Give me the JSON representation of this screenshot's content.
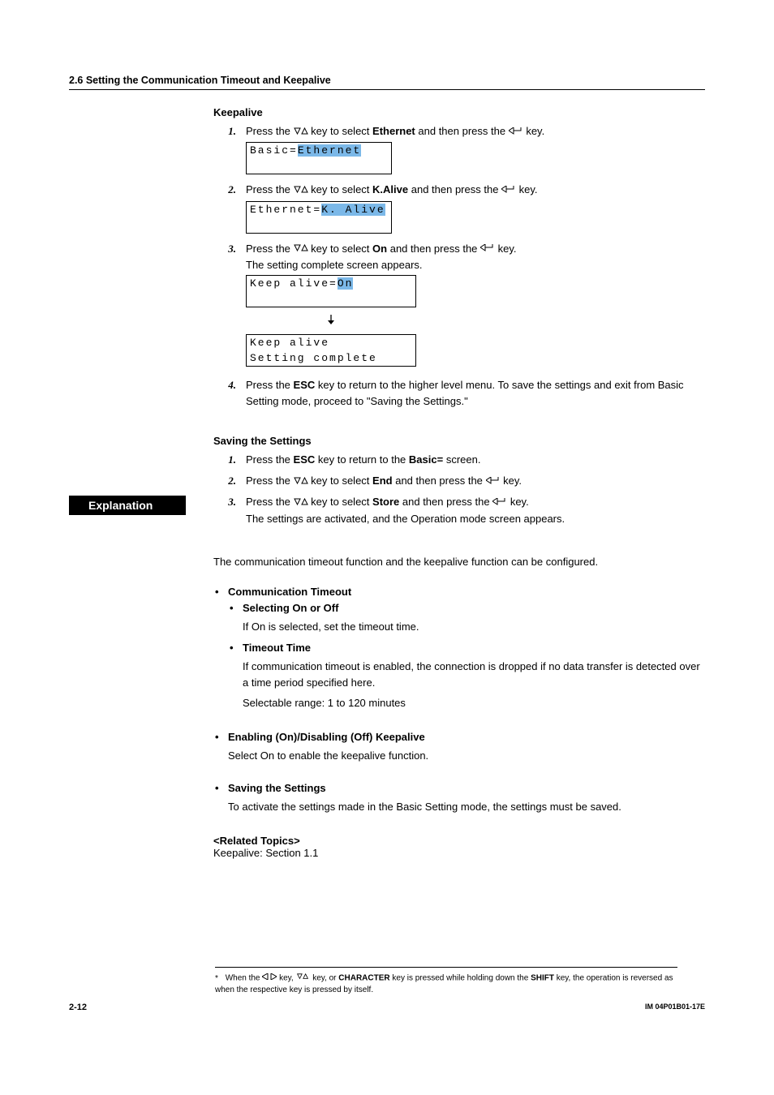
{
  "header": {
    "title": "2.6  Setting the Communication Timeout and Keepalive"
  },
  "keepalive": {
    "heading": "Keepalive",
    "steps": [
      {
        "num": "1.",
        "pre": "Press the ",
        "mid1": " key to select ",
        "sel": "Ethernet",
        "mid2": " and then press the ",
        "post": " key.",
        "lcd_lines": [
          {
            "prefix": "Basic=",
            "highlight": "Ethernet",
            "suffix": ""
          }
        ]
      },
      {
        "num": "2.",
        "pre": "Press the ",
        "mid1": " key to select ",
        "sel": "K.Alive",
        "mid2": " and then press the ",
        "post": " key.",
        "lcd_lines": [
          {
            "prefix": "Ethernet=",
            "highlight": "K. Alive",
            "suffix": ""
          }
        ]
      },
      {
        "num": "3.",
        "pre": "Press the ",
        "mid1": " key to select ",
        "sel": "On",
        "mid2": " and then press the ",
        "post": " key.",
        "after": "The setting complete screen appears.",
        "lcd_lines": [
          {
            "prefix": "Keep alive=",
            "highlight": "On",
            "suffix": ""
          }
        ],
        "lcd_lines2": [
          {
            "prefix": "Keep alive",
            "highlight": "",
            "suffix": ""
          },
          {
            "prefix": "Setting complete",
            "highlight": "",
            "suffix": ""
          }
        ]
      },
      {
        "num": "4.",
        "text_a": "Press the ",
        "esc": "ESC",
        "text_b": " key to return to the higher level menu. To save the settings and exit from Basic Setting mode, proceed to \"Saving the Settings.\""
      }
    ]
  },
  "saving": {
    "heading": "Saving the Settings",
    "steps": [
      {
        "num": "1.",
        "a": "Press the ",
        "k": "ESC",
        "b": " key to return to the ",
        "k2": "Basic=",
        "c": " screen."
      },
      {
        "num": "2.",
        "a": "Press the ",
        "mid": " key to select ",
        "sel": "End",
        "b": " and then press the ",
        "c": " key."
      },
      {
        "num": "3.",
        "a": "Press the ",
        "mid": " key to select ",
        "sel": "Store",
        "b": " and then press the ",
        "c": " key.",
        "after": "The settings are activated, and the Operation mode screen appears."
      }
    ]
  },
  "explanation": {
    "band": "Explanation",
    "intro": "The communication timeout function and the keepalive function can be configured.",
    "items": [
      {
        "title": "Communication Timeout",
        "subs": [
          {
            "title": "Selecting On or Off",
            "body": [
              "If On is selected, set the timeout time."
            ]
          },
          {
            "title": "Timeout Time",
            "body": [
              "If communication timeout is enabled, the connection is dropped if no data transfer is detected over a time period specified here.",
              "Selectable range: 1 to 120 minutes"
            ]
          }
        ]
      },
      {
        "title": "Enabling (On)/Disabling (Off) Keepalive",
        "body": [
          "Select On to enable the keepalive function."
        ]
      },
      {
        "title": "Saving the Settings",
        "body": [
          "To activate the settings made in the Basic Setting mode, the settings must be saved."
        ]
      }
    ],
    "related_head": "<Related Topics>",
    "related_body": "Keepalive: Section 1.1"
  },
  "footnote": {
    "ast": "*",
    "a": "When the ",
    "b": " key, ",
    "c": " key, or ",
    "char": "CHARACTER",
    "d": " key is pressed while holding down the ",
    "shift": "SHIFT",
    "e": " key, the operation is reversed as when the respective key is pressed by itself."
  },
  "footer": {
    "page": "2-12",
    "docid": "IM 04P01B01-17E"
  }
}
